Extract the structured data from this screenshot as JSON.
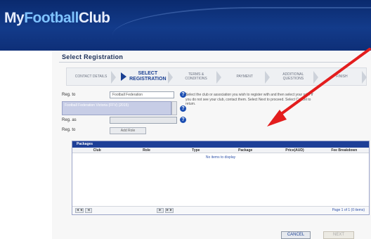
{
  "header": {
    "logo": {
      "part1": "My",
      "part2": "Football",
      "part3": "Club"
    }
  },
  "page": {
    "title": "Select Registration"
  },
  "steps": [
    {
      "label": "CONTACT DETAILS",
      "active": false
    },
    {
      "label": "SELECT REGISTRATION",
      "active": true
    },
    {
      "label": "TERMS & CONDITIONS",
      "active": false
    },
    {
      "label": "PAYMENT",
      "active": false
    },
    {
      "label": "ADDITIONAL QUESTIONS",
      "active": false
    },
    {
      "label": "FINISH",
      "active": false
    }
  ],
  "form": {
    "label1": "Reg. to",
    "field1_value": "Football Federation",
    "regbox_text": "Football Federation Victoria (FFV) (2015)",
    "label2": "Reg. as",
    "label3": "Reg. to",
    "button_small": "Add Role"
  },
  "info_text": "Select the club or association you wish to register with and then select your role. If you do not see your club, contact them. Select Next to proceed. Select Cancel to return.",
  "panel": {
    "title": "Packages",
    "columns": [
      "Club",
      "Role",
      "Type",
      "Package",
      "Price(AUD)",
      "Fee Breakdown"
    ],
    "empty_text": "No items to display",
    "pager_info": "Page 1 of 1 (0 items)"
  },
  "pager": {
    "first": "◄◄",
    "prev": "◄",
    "next": "►",
    "last": "►►"
  },
  "buttons": {
    "cancel": "CANCEL",
    "next": "NEXT"
  },
  "annotation": {
    "arrow_color": "#e31d1d"
  },
  "colors": {
    "header": "#133b8a",
    "accent": "#1a3f92"
  }
}
